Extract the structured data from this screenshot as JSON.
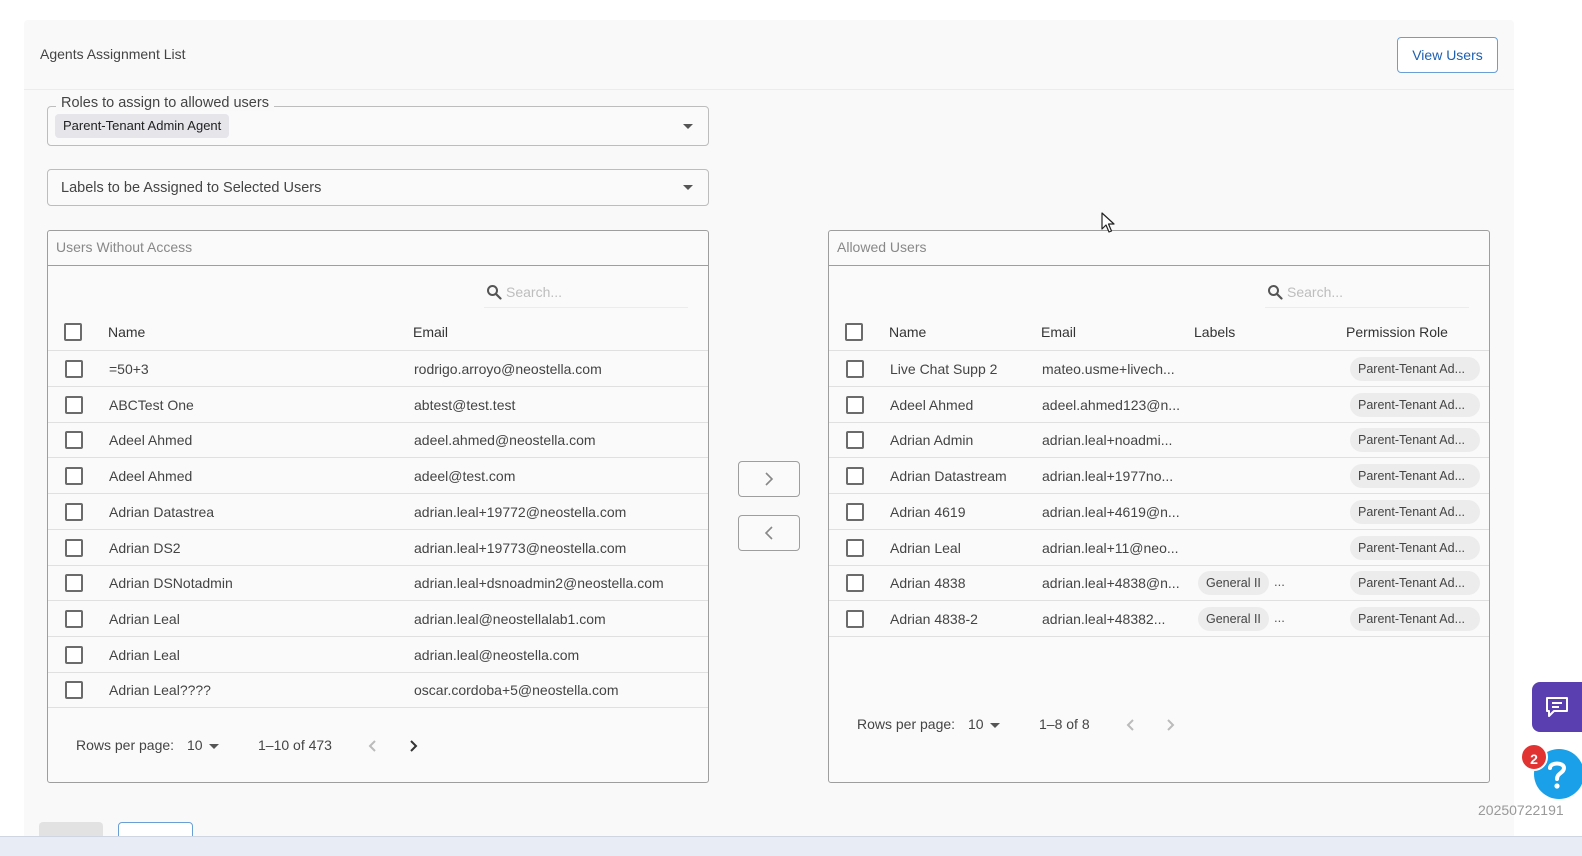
{
  "header": {
    "title": "Agents Assignment List",
    "view_users_label": "View Users"
  },
  "roles_field": {
    "legend": "Roles to assign to allowed users",
    "selected": "Parent-Tenant Admin Agent"
  },
  "labels_field": {
    "placeholder": "Labels to be Assigned to Selected Users"
  },
  "left_panel": {
    "title": "Users Without Access",
    "search_placeholder": "Search...",
    "columns": {
      "name": "Name",
      "email": "Email"
    },
    "rows": [
      {
        "name": "=50+3",
        "email": "rodrigo.arroyo@neostella.com"
      },
      {
        "name": "ABCTest One",
        "email": "abtest@test.test"
      },
      {
        "name": "Adeel Ahmed",
        "email": "adeel.ahmed@neostella.com"
      },
      {
        "name": "Adeel Ahmed",
        "email": "adeel@test.com"
      },
      {
        "name": "Adrian Datastrea",
        "email": "adrian.leal+19772@neostella.com"
      },
      {
        "name": "Adrian DS2",
        "email": "adrian.leal+19773@neostella.com"
      },
      {
        "name": "Adrian DSNotadmin",
        "email": "adrian.leal+dsnoadmin2@neostella.com"
      },
      {
        "name": "Adrian Leal",
        "email": "adrian.leal@neostellalab1.com"
      },
      {
        "name": "Adrian Leal",
        "email": "adrian.leal@neostella.com"
      },
      {
        "name": "Adrian Leal????",
        "email": "oscar.cordoba+5@neostella.com"
      }
    ],
    "pager": {
      "rows_per_page_label": "Rows per page:",
      "rows_per_page": "10",
      "range": "1–10 of 473"
    }
  },
  "right_panel": {
    "title": "Allowed Users",
    "search_placeholder": "Search...",
    "columns": {
      "name": "Name",
      "email": "Email",
      "labels": "Labels",
      "role": "Permission Role"
    },
    "rows": [
      {
        "name": "Live Chat Supp 2",
        "email": "mateo.usme+livech...",
        "label": "",
        "more": "",
        "role": "Parent-Tenant Ad..."
      },
      {
        "name": "Adeel Ahmed",
        "email": "adeel.ahmed123@n...",
        "label": "",
        "more": "",
        "role": "Parent-Tenant Ad..."
      },
      {
        "name": "Adrian Admin",
        "email": "adrian.leal+noadmi...",
        "label": "",
        "more": "",
        "role": "Parent-Tenant Ad..."
      },
      {
        "name": "Adrian Datastream",
        "email": "adrian.leal+1977no...",
        "label": "",
        "more": "",
        "role": "Parent-Tenant Ad..."
      },
      {
        "name": "Adrian 4619",
        "email": "adrian.leal+4619@n...",
        "label": "",
        "more": "",
        "role": "Parent-Tenant Ad..."
      },
      {
        "name": "Adrian Leal",
        "email": "adrian.leal+11@neo...",
        "label": "",
        "more": "",
        "role": "Parent-Tenant Ad..."
      },
      {
        "name": "Adrian 4838",
        "email": "adrian.leal+4838@n...",
        "label": "General II",
        "more": "...",
        "role": "Parent-Tenant Ad..."
      },
      {
        "name": "Adrian 4838-2",
        "email": "adrian.leal+48382...",
        "label": "General II",
        "more": "...",
        "role": "Parent-Tenant Ad..."
      }
    ],
    "pager": {
      "rows_per_page_label": "Rows per page:",
      "rows_per_page": "10",
      "range": "1–8 of 8"
    }
  },
  "help": {
    "badge_count": "2"
  },
  "version_text": "20250722191",
  "icons": {
    "search": "search-icon",
    "dropdown": "caret-down-icon",
    "move_right": "chevron-right-icon",
    "move_left": "chevron-left-icon",
    "chat": "chat-icon",
    "help": "question-icon",
    "cursor": "mouse-pointer-icon"
  },
  "colors": {
    "primary": "#1d5fb0",
    "chat": "#5a3fb0",
    "help": "#1aa0e8",
    "badge": "#e23333"
  }
}
